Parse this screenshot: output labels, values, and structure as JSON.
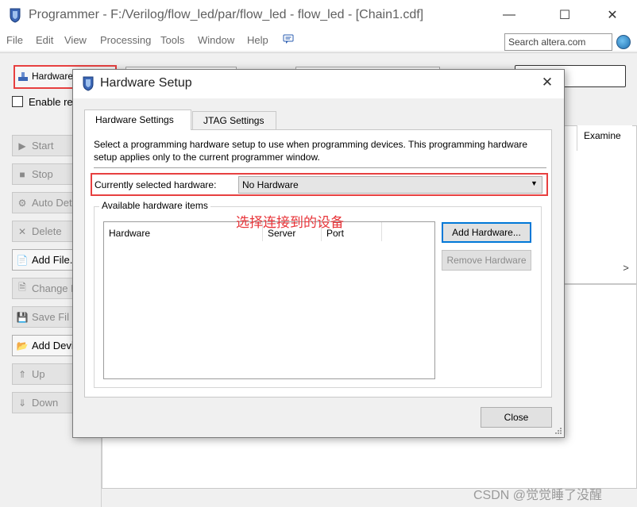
{
  "window": {
    "title": "Programmer - F:/Verilog/flow_led/par/flow_led - flow_led - [Chain1.cdf]",
    "min_icon": "—",
    "max_icon": "☐",
    "close_icon": "✕"
  },
  "menu": [
    "File",
    "Edit",
    "View",
    "Processing",
    "Tools",
    "Window",
    "Help"
  ],
  "search": {
    "placeholder": "Search altera.com"
  },
  "toolbar": {
    "hardware_setup_label": "Hardware",
    "enable_label": "Enable re"
  },
  "sidebar": {
    "items": [
      {
        "label": "Start",
        "icon": "▶",
        "enabled": false
      },
      {
        "label": "Stop",
        "icon": "■",
        "enabled": false
      },
      {
        "label": "Auto Dete",
        "icon": "⚙",
        "enabled": false
      },
      {
        "label": "Delete",
        "icon": "✕",
        "enabled": false
      },
      {
        "label": "Add File...",
        "icon": "📄",
        "enabled": true
      },
      {
        "label": "Change Fi",
        "icon": "🗎",
        "enabled": false
      },
      {
        "label": "Save Fil",
        "icon": "💾",
        "enabled": false
      },
      {
        "label": "Add Devic",
        "icon": "📂",
        "enabled": true
      },
      {
        "label": "Up",
        "icon": "⇑",
        "enabled": false
      },
      {
        "label": "Down",
        "icon": "⇓",
        "enabled": false
      }
    ]
  },
  "main": {
    "examine_header": "Examine",
    "scroll_right_icon": ">"
  },
  "dialog": {
    "title": "Hardware Setup",
    "close_icon": "✕",
    "tabs": [
      "Hardware Settings",
      "JTAG Settings"
    ],
    "description": "Select a programming hardware setup to use when programming devices. This programming hardware setup applies only to the current programmer window.",
    "currently_selected_label": "Currently selected hardware:",
    "selected_hardware": "No Hardware",
    "available_group_title": "Available hardware items",
    "table_headers": [
      "Hardware",
      "Server",
      "Port"
    ],
    "add_hardware_label": "Add Hardware...",
    "remove_hardware_label": "Remove Hardware",
    "close_label": "Close"
  },
  "annotation": "选择连接到的设备",
  "watermark": "CSDN @觉觉睡了没醒",
  "colors": {
    "highlight_red": "#e74040",
    "annotation_red": "#e8353a",
    "focus_blue": "#0078d7"
  }
}
